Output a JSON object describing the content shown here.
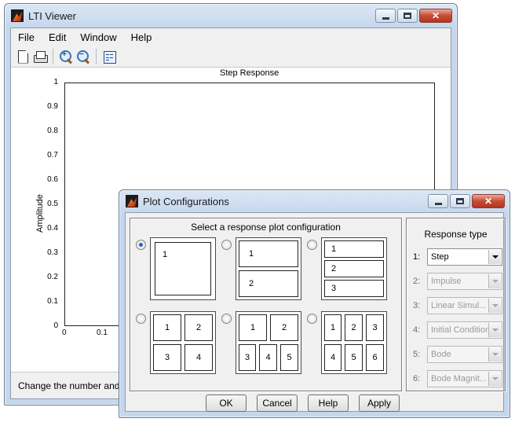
{
  "lti_window": {
    "title": "LTI Viewer",
    "menu": [
      "File",
      "Edit",
      "Window",
      "Help"
    ],
    "toolbar_icons": [
      "new-file-icon",
      "print-icon",
      "zoom-in-icon",
      "zoom-out-icon",
      "grid-config-icon"
    ],
    "status_text": "Change the number and typ"
  },
  "plot": {
    "title": "Step Response",
    "ylabel": "Amplitude",
    "yticks": [
      "1",
      "0.9",
      "0.8",
      "0.7",
      "0.6",
      "0.5",
      "0.4",
      "0.3",
      "0.2",
      "0.1",
      "0"
    ],
    "xticks": [
      "0",
      "0.1"
    ]
  },
  "dialog": {
    "title": "Plot Configurations",
    "config_group_title": "Select a response plot configuration",
    "configs": [
      {
        "cells": [
          "1"
        ],
        "selected": true
      },
      {
        "cells": [
          "1",
          "2"
        ],
        "selected": false
      },
      {
        "cells": [
          "1",
          "2",
          "3"
        ],
        "selected": false
      },
      {
        "cells": [
          "1",
          "2",
          "3",
          "4"
        ],
        "selected": false
      },
      {
        "cells": [
          "1",
          "2",
          "3",
          "4",
          "5"
        ],
        "selected": false
      },
      {
        "cells": [
          "1",
          "2",
          "3",
          "4",
          "5",
          "6"
        ],
        "selected": false
      }
    ],
    "response_group_title": "Response type",
    "responses": [
      {
        "num": "1:",
        "value": "Step",
        "enabled": true
      },
      {
        "num": "2:",
        "value": "Impulse",
        "enabled": false
      },
      {
        "num": "3:",
        "value": "Linear Simul...",
        "enabled": false
      },
      {
        "num": "4:",
        "value": "Initial Condition",
        "enabled": false
      },
      {
        "num": "5:",
        "value": "Bode",
        "enabled": false
      },
      {
        "num": "6:",
        "value": "Bode Magnit...",
        "enabled": false
      }
    ],
    "buttons": {
      "ok": "OK",
      "cancel": "Cancel",
      "help": "Help",
      "apply": "Apply"
    }
  }
}
